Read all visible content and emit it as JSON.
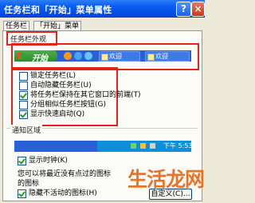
{
  "window": {
    "title": "任务栏和「开始」菜单属性",
    "help_label": "?",
    "close_label": "×"
  },
  "tabs": [
    {
      "label": "任务栏"
    },
    {
      "label": "「开始」菜单"
    }
  ],
  "appearance_group": {
    "label": "任务栏外观",
    "preview": {
      "start_label": "开始",
      "task_buttons": [
        {
          "label": "欢迎"
        },
        {
          "label": "欢迎"
        }
      ]
    },
    "options": [
      {
        "label": "锁定任务栏(L)",
        "checked": false
      },
      {
        "label": "自动隐藏任务栏(U)",
        "checked": false
      },
      {
        "label": "将任务栏保持在其它窗口的前端(T)",
        "checked": true
      },
      {
        "label": "分组相似任务栏按钮(G)",
        "checked": false
      },
      {
        "label": "显示快速启动(Q)",
        "checked": true
      }
    ]
  },
  "notification_group": {
    "label": "通知区域",
    "clock_text": "下午 5:53",
    "show_clock": {
      "label": "显示时钟(K)",
      "checked": true
    },
    "description": "您可以将最近没有点过的图标",
    "description_cont": "的图标",
    "hide_inactive": {
      "label": "隐藏不活动的图标(H)",
      "checked": true
    },
    "customize_label": "自定义(C)..."
  },
  "watermark": "生活龙网",
  "colors": {
    "titlebar": "#0a5ef0",
    "highlight_box": "#e2231a",
    "taskbar": "#2a5fd8",
    "start_button": "#3a9d3a",
    "dialog_bg": "#ece9d8"
  }
}
